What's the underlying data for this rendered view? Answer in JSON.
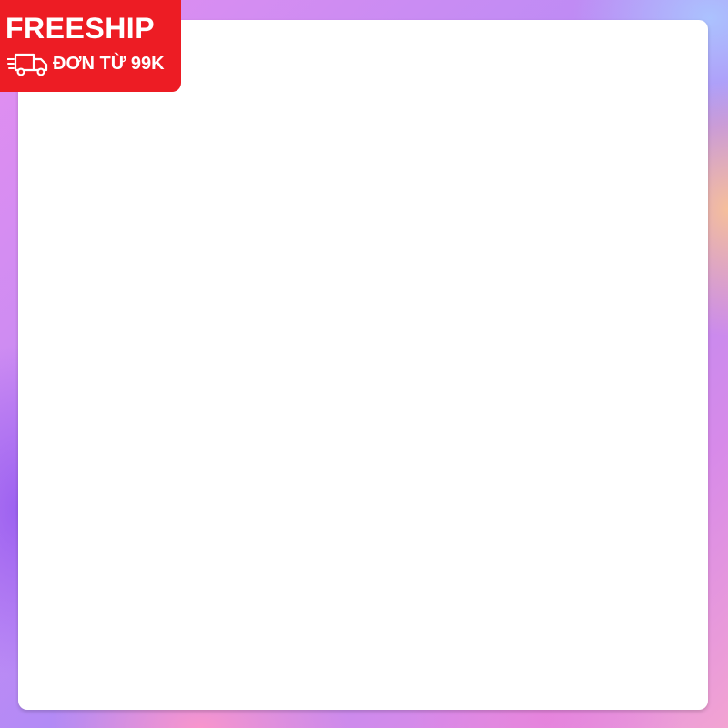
{
  "badge": {
    "title": "FREESHIP",
    "subtitle": "ĐƠN TỪ 99K",
    "icon": "delivery-truck-icon",
    "background_color": "#ed1c24",
    "text_color": "#ffffff"
  },
  "frame": {
    "panel_color": "#ffffff",
    "border_colors": [
      "#e48ef0",
      "#b18af6",
      "#f2a3d2",
      "#ffc88c",
      "#aac8ff"
    ]
  }
}
